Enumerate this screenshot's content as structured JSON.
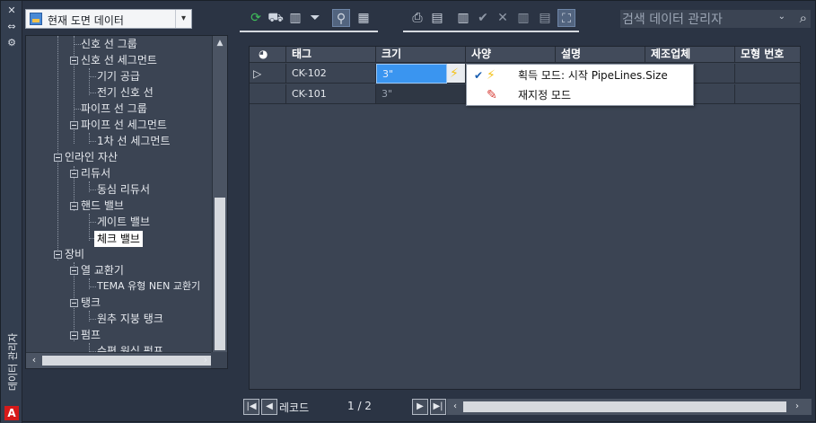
{
  "side_strip": {
    "title": "데이터 관리자",
    "close_glyph": "✕",
    "pin_glyph": "⇔",
    "settings_glyph": "⚙",
    "logo_text": "A",
    "logo_color": "#d61a1a"
  },
  "source_dropdown": {
    "selected": "현재 도면 데이터",
    "arrow": "▾"
  },
  "tree": {
    "items": [
      {
        "label": "신호 선 그룹"
      },
      {
        "label": "신호 선 세그먼트"
      },
      {
        "label": "기기 공급"
      },
      {
        "label": "전기 신호 선"
      },
      {
        "label": "파이프 선 그룹"
      },
      {
        "label": "파이프 선 세그먼트"
      },
      {
        "label": "1차 선 세그먼트"
      },
      {
        "label": "인라인 자산"
      },
      {
        "label": "리듀서"
      },
      {
        "label": "동심 리듀서"
      },
      {
        "label": "핸드 밸브"
      },
      {
        "label": "게이트 밸브"
      },
      {
        "label": "체크 밸브",
        "selected": true
      },
      {
        "label": "장비"
      },
      {
        "label": "열 교환기"
      },
      {
        "label": "TEMA 유형 NEN 교환기"
      },
      {
        "label": "탱크"
      },
      {
        "label": "원추 지붕 탱크"
      },
      {
        "label": "펌프"
      },
      {
        "label": "수평 원심 펌프"
      }
    ]
  },
  "toolbar": {
    "icons": [
      "refresh-icon",
      "zoom-to-icon",
      "column-filter-icon",
      "filter-icon",
      "search-icon",
      "highlight-icon",
      "print-icon",
      "export-icon",
      "import-icon",
      "accept-icon",
      "reject-icon",
      "columns-icon",
      "hide-columns-icon",
      "lasso-icon"
    ],
    "accent": "#52647f"
  },
  "search": {
    "placeholder": "검색 데이터 관리자",
    "chevron": "⌄",
    "icon": "⌕"
  },
  "grid": {
    "columns": [
      "태그",
      "크기",
      "사양",
      "설명",
      "제조업체",
      "모형 번호"
    ],
    "rows": [
      {
        "marker": "▷",
        "tag": "CK-102",
        "size": "3\"",
        "editing": true
      },
      {
        "marker": "",
        "tag": "CK-101",
        "size": "3\""
      }
    ]
  },
  "size_menu": {
    "items": [
      {
        "checked": true,
        "icon": "lightning-icon",
        "label": "획득 모드: 시작 PipeLines.Size"
      },
      {
        "checked": false,
        "icon": "pencil-icon",
        "label": "재지정 모드"
      }
    ]
  },
  "record_nav": {
    "label": "레코드",
    "position": "1 / 2"
  }
}
